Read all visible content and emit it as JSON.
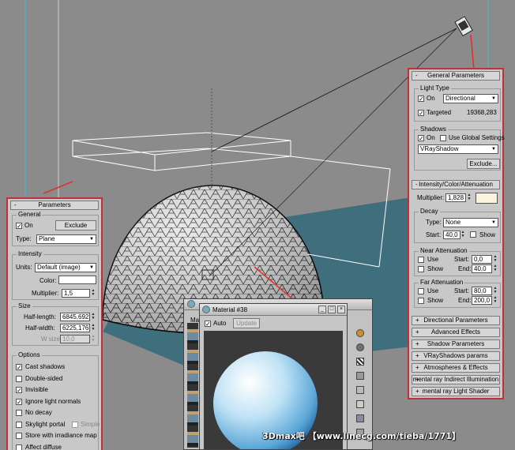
{
  "general_parameters": {
    "title": "General Parameters",
    "collapse_sign": "-",
    "light_type": {
      "group_title": "Light Type",
      "on_label": "On",
      "on_checked": "✓",
      "type_value": "Directional",
      "targeted_label": "Targeted",
      "targeted_checked": "✓",
      "target_distance": "19368,283"
    },
    "shadows": {
      "group_title": "Shadows",
      "on_label": "On",
      "on_checked": "✓",
      "global_label": "Use Global Settings",
      "type_value": "VRayShadow",
      "exclude_label": "Exclude..."
    }
  },
  "intensity": {
    "title": "Intensity/Color/Attenuation",
    "collapse_sign": "-",
    "multiplier_label": "Multiplier:",
    "multiplier_value": "1,828",
    "decay": {
      "group_title": "Decay",
      "type_label": "Type:",
      "type_value": "None",
      "start_label": "Start:",
      "start_value": "40,0",
      "show_label": "Show"
    },
    "near": {
      "group_title": "Near Attenuation",
      "use_label": "Use",
      "show_label": "Show",
      "start_label": "Start:",
      "start_value": "0,0",
      "end_label": "End:",
      "end_value": "40,0"
    },
    "far": {
      "group_title": "Far Attenuation",
      "use_label": "Use",
      "show_label": "Show",
      "start_label": "Start:",
      "start_value": "80,0",
      "end_label": "End:",
      "end_value": "200,0"
    }
  },
  "collapsed_rollouts": [
    {
      "sign": "+",
      "label": "Directional Parameters"
    },
    {
      "sign": "+",
      "label": "Advanced Effects"
    },
    {
      "sign": "+",
      "label": "Shadow Parameters"
    },
    {
      "sign": "+",
      "label": "VRayShadows params"
    },
    {
      "sign": "+",
      "label": "Atmospheres & Effects"
    },
    {
      "sign": "+",
      "label": "mental ray Indirect Illumination"
    },
    {
      "sign": "+",
      "label": "mental ray Light Shader"
    }
  ],
  "parameters": {
    "title": "Parameters",
    "collapse_sign": "-",
    "general": {
      "group_title": "General",
      "on_label": "On",
      "on_checked": "✓",
      "exclude_label": "Exclude",
      "type_label": "Type:",
      "type_value": "Plane"
    },
    "intensity": {
      "group_title": "Intensity",
      "units_label": "Units:",
      "units_value": "Default (image)",
      "color_label": "Color:",
      "multiplier_label": "Multiplier:",
      "multiplier_value": "1,5"
    },
    "size": {
      "group_title": "Size",
      "half_length_label": "Half-length:",
      "half_length_value": "6845,692",
      "half_width_label": "Half-width:",
      "half_width_value": "6225,176",
      "w_size_label": "W size",
      "w_size_value": "10,0"
    },
    "options": {
      "group_title": "Options",
      "items": [
        {
          "label": "Cast shadows",
          "mark": "✓"
        },
        {
          "label": "Double-sided",
          "mark": ""
        },
        {
          "label": "Invisible",
          "mark": "✓"
        },
        {
          "label": "Ignore light normals",
          "mark": "✓"
        },
        {
          "label": "No decay",
          "mark": ""
        },
        {
          "label": "Skylight portal",
          "mark": ""
        },
        {
          "label": "Store with irradiance map",
          "mark": ""
        },
        {
          "label": "Affect diffuse",
          "mark": ""
        }
      ],
      "simple_label": "Simple"
    }
  },
  "material_editor": {
    "title": "Material #38",
    "auto_label": "Auto",
    "auto_checked": "✓",
    "update_label": "Update",
    "back_window_label": "Ma"
  },
  "watermark": "3Dmax吧  【www.linecg.com/tieba/1771】",
  "colors": {
    "panel_border": "#c0303a",
    "panel_bg": "#c8c8c8",
    "viewport_bg": "#8b8b8b",
    "ground": "#3f6f7d",
    "light_color": "#fbf3dc"
  }
}
